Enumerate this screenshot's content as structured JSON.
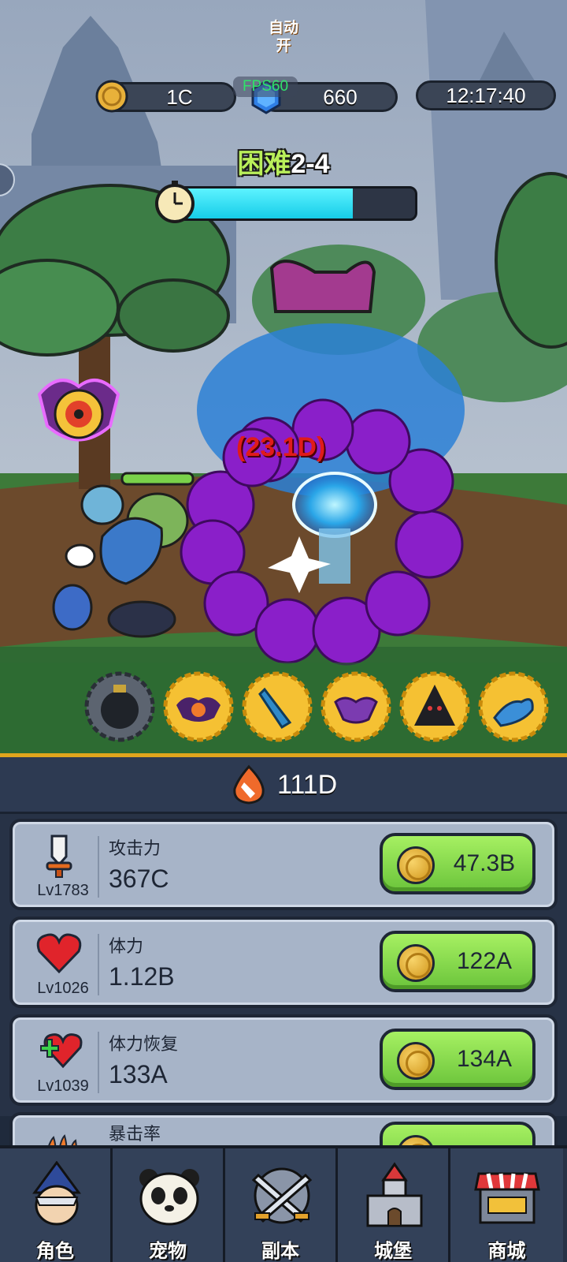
{
  "hud": {
    "gold": "1C",
    "gems": "660",
    "clock": "12:17:40",
    "fps": "FPS60"
  },
  "stage": {
    "difficulty": "困难",
    "level": "2-4",
    "progress": 0.74
  },
  "combat": {
    "damage_popup": "(23.1D)"
  },
  "skills": {
    "auto_label": "自动\n开",
    "items": [
      {
        "name": "bomb-skill",
        "locked": true
      },
      {
        "name": "bat-eye-skill"
      },
      {
        "name": "crystal-skill"
      },
      {
        "name": "purple-bat-skill"
      },
      {
        "name": "dark-mountain-skill"
      },
      {
        "name": "blue-dragon-skill"
      }
    ]
  },
  "panel": {
    "total_power": "111D",
    "upgrades": [
      {
        "name": "攻击力",
        "value": "367C",
        "level": "Lv1783",
        "price": "47.3B",
        "icon": "sword-icon"
      },
      {
        "name": "体力",
        "value": "1.12B",
        "level": "Lv1026",
        "price": "122A",
        "icon": "heart-icon"
      },
      {
        "name": "体力恢复",
        "value": "133A",
        "level": "Lv1039",
        "price": "134A",
        "icon": "heart-regen-icon"
      },
      {
        "name": "暴击率",
        "icon": "claw-icon"
      }
    ]
  },
  "nav": [
    {
      "label": "角色",
      "icon": "wizard-icon"
    },
    {
      "label": "宠物",
      "icon": "panda-icon"
    },
    {
      "label": "副本",
      "icon": "crossed-swords-icon"
    },
    {
      "label": "城堡",
      "icon": "castle-icon"
    },
    {
      "label": "商城",
      "icon": "shop-icon"
    }
  ],
  "colors": {
    "accent_gold": "#e0a51d",
    "button_green": "#7fd447",
    "timer_cyan": "#1ad6ee"
  }
}
